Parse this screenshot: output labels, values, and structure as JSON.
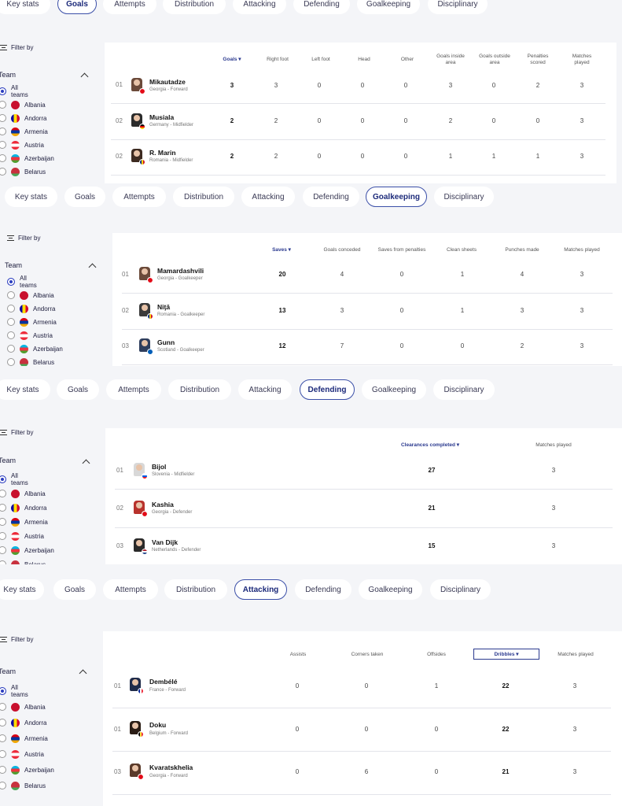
{
  "tabs_order": [
    "Key stats",
    "Goals",
    "Attempts",
    "Distribution",
    "Attacking",
    "Defending",
    "Goalkeeping",
    "Disciplinary"
  ],
  "filter_label": "Filter by",
  "team_label": "Team",
  "team_options": [
    "All teams",
    "Albania",
    "Andorra",
    "Armenia",
    "Austria",
    "Azerbaijan",
    "Belarus"
  ],
  "flag_colors": [
    "#c8102e",
    "#f4c300",
    "#d90012",
    "#ed2939",
    "#00b5e2",
    "#c8313e"
  ],
  "panels": {
    "goals": {
      "active_tab": "Goals",
      "headers": [
        "Goals ▾",
        "Right foot",
        "Left foot",
        "Head",
        "Other",
        "Goals inside area",
        "Goals outside area",
        "Penalties scored",
        "Matches played"
      ],
      "rows": [
        {
          "rank": "01",
          "name": "Mikautadze",
          "meta": "Georgia - Forward",
          "values": [
            "3",
            "3",
            "0",
            "0",
            "0",
            "3",
            "0",
            "2",
            "3"
          ]
        },
        {
          "rank": "02",
          "name": "Musiala",
          "meta": "Germany - Midfielder",
          "values": [
            "2",
            "2",
            "0",
            "0",
            "0",
            "2",
            "0",
            "0",
            "3"
          ]
        },
        {
          "rank": "02",
          "name": "R. Marin",
          "meta": "Romania - Midfielder",
          "values": [
            "2",
            "2",
            "0",
            "0",
            "0",
            "1",
            "1",
            "1",
            "3"
          ]
        }
      ]
    },
    "goalkeeping": {
      "active_tab": "Goalkeeping",
      "headers": [
        "Saves ▾",
        "Goals conceded",
        "Saves from penalties",
        "Clean sheets",
        "Punches made",
        "Matches played"
      ],
      "rows": [
        {
          "rank": "01",
          "name": "Mamardashvili",
          "meta": "Georgia - Goalkeeper",
          "values": [
            "20",
            "4",
            "0",
            "1",
            "4",
            "3"
          ]
        },
        {
          "rank": "02",
          "name": "Niţă",
          "meta": "Romania - Goalkeeper",
          "values": [
            "13",
            "3",
            "0",
            "1",
            "3",
            "3"
          ]
        },
        {
          "rank": "03",
          "name": "Gunn",
          "meta": "Scotland - Goalkeeper",
          "values": [
            "12",
            "7",
            "0",
            "0",
            "2",
            "3"
          ]
        }
      ]
    },
    "defending": {
      "active_tab": "Defending",
      "headers": [
        "Clearances completed ▾",
        "Matches played"
      ],
      "rows": [
        {
          "rank": "01",
          "name": "Bijol",
          "meta": "Slovenia - Midfielder",
          "values": [
            "27",
            "3"
          ]
        },
        {
          "rank": "02",
          "name": "Kashia",
          "meta": "Georgia - Defender",
          "values": [
            "21",
            "3"
          ]
        },
        {
          "rank": "03",
          "name": "Van Dijk",
          "meta": "Netherlands - Defender",
          "values": [
            "15",
            "3"
          ]
        }
      ]
    },
    "attacking": {
      "active_tab": "Attacking",
      "headers": [
        "Assists",
        "Corners taken",
        "Offsides",
        "Dribbles ▾",
        "Matches played"
      ],
      "rows": [
        {
          "rank": "01",
          "name": "Dembélé",
          "meta": "France - Forward",
          "values": [
            "0",
            "0",
            "1",
            "22",
            "3"
          ]
        },
        {
          "rank": "01",
          "name": "Doku",
          "meta": "Belgium - Forward",
          "values": [
            "0",
            "0",
            "0",
            "22",
            "3"
          ]
        },
        {
          "rank": "03",
          "name": "Kvaratskhelia",
          "meta": "Georgia - Forward",
          "values": [
            "0",
            "6",
            "0",
            "21",
            "3"
          ]
        }
      ]
    }
  }
}
